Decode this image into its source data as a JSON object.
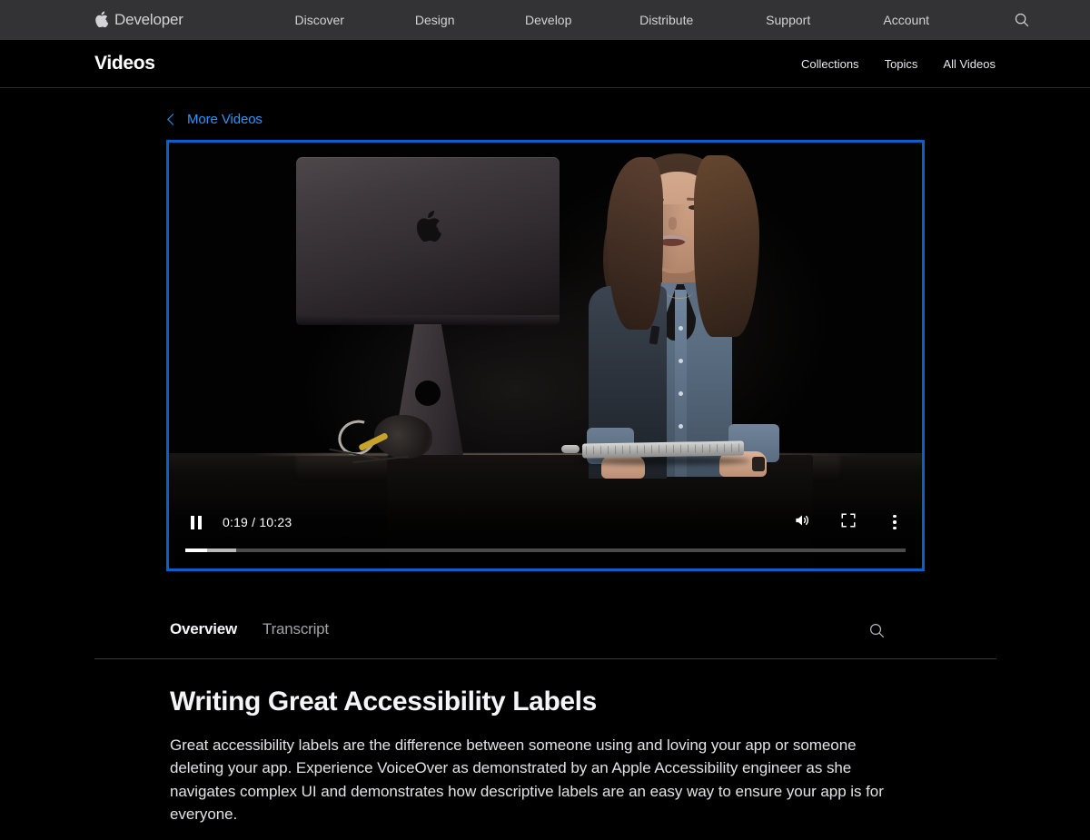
{
  "global_nav": {
    "brand": "Developer",
    "brand_icon": "apple-logo-icon",
    "links": [
      "Discover",
      "Design",
      "Develop",
      "Distribute",
      "Support",
      "Account"
    ],
    "search_icon": "search-icon",
    "background": "#333336",
    "text_color": "#d2d2d7"
  },
  "local_nav": {
    "title": "Videos",
    "links": [
      "Collections",
      "Topics",
      "All Videos"
    ]
  },
  "back": {
    "icon": "chevron-left-icon",
    "label": "More Videos",
    "color": "#2997ff"
  },
  "player": {
    "focus_ring_color": "#0a5fc8",
    "state": "playing",
    "play_pause_icon": "pause-icon",
    "current_time": "0:19",
    "duration": "10:23",
    "time_display": "0:19 / 10:23",
    "played_percent": 3,
    "buffered_percent": 7,
    "volume_icon": "volume-icon",
    "fullscreen_icon": "fullscreen-icon",
    "more_options_icon": "more-vertical-icon",
    "scene_description": "Presenter standing at a podium next to a space gray iMac Pro on a dark stage"
  },
  "tabs": {
    "items": [
      {
        "label": "Overview",
        "active": true
      },
      {
        "label": "Transcript",
        "active": false
      }
    ],
    "search_icon": "search-icon"
  },
  "article": {
    "title": "Writing Great Accessibility Labels",
    "body": "Great accessibility labels are the difference between someone using and loving your app or someone deleting your app. Experience VoiceOver as demonstrated by an Apple Accessibility engineer as she navigates complex UI and demonstrates how descriptive labels are an easy way to ensure your app is for everyone."
  }
}
